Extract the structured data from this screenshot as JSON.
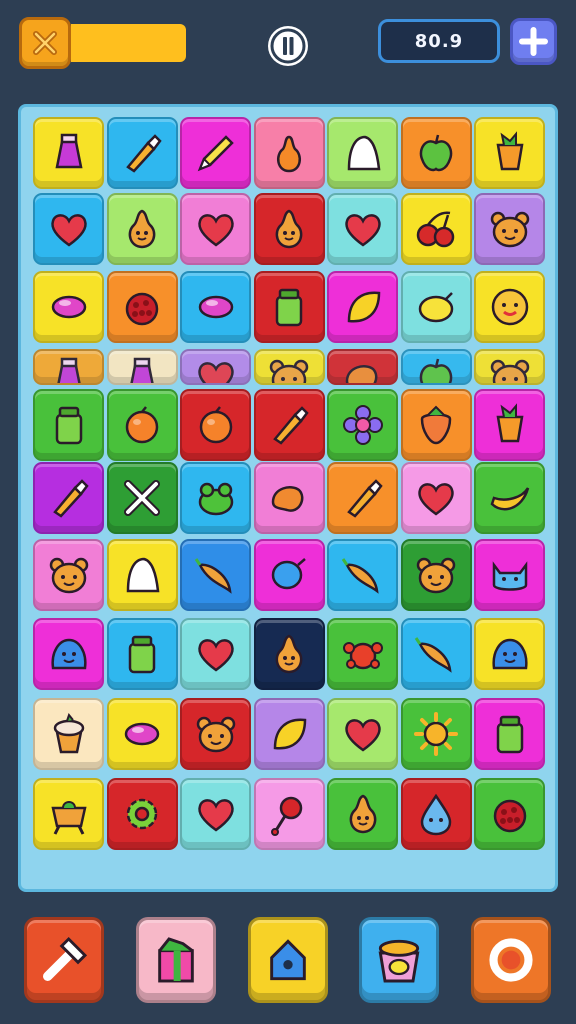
{
  "hud": {
    "score": "80.9",
    "progress": 1.0,
    "colors": {
      "accent": "#ffbf1e",
      "score_border": "#3c8fdc",
      "add": "#6f7ef0"
    }
  },
  "board": {
    "columns": 7,
    "rows": [
      {
        "half": false,
        "tiles": [
          {
            "color": "#f7e227",
            "icon": "bottle"
          },
          {
            "color": "#2fb7ef",
            "icon": "brush"
          },
          {
            "color": "#ee2fd8",
            "icon": "pencil"
          },
          {
            "color": "#f77fa8",
            "icon": "pear"
          },
          {
            "color": "#a6e86d",
            "icon": "ghost"
          },
          {
            "color": "#f7902a",
            "icon": "apple"
          },
          {
            "color": "#f7e227",
            "icon": "carrot"
          }
        ]
      },
      {
        "half": false,
        "tiles": [
          {
            "color": "#2fb7ef",
            "icon": "heart"
          },
          {
            "color": "#a6e86d",
            "icon": "pear-face"
          },
          {
            "color": "#f17ed6",
            "icon": "heart"
          },
          {
            "color": "#d6262a",
            "icon": "pear-face"
          },
          {
            "color": "#7ee0e0",
            "icon": "heart"
          },
          {
            "color": "#f7e227",
            "icon": "cherry"
          },
          {
            "color": "#b586e8",
            "icon": "bear"
          }
        ]
      },
      {
        "half": false,
        "tiles": [
          {
            "color": "#f7e227",
            "icon": "candy"
          },
          {
            "color": "#f7902a",
            "icon": "berry"
          },
          {
            "color": "#2fb7ef",
            "icon": "candy"
          },
          {
            "color": "#d6262a",
            "icon": "jar"
          },
          {
            "color": "#ee2fd8",
            "icon": "leaf"
          },
          {
            "color": "#7ee0e0",
            "icon": "lemon"
          },
          {
            "color": "#f7e227",
            "icon": "sun-face"
          }
        ]
      },
      {
        "half": true,
        "tiles": [
          {
            "color": "#f7a62a",
            "icon": "bottle"
          },
          {
            "color": "#fbe7bf",
            "icon": "bottle"
          },
          {
            "color": "#b586e8",
            "icon": "heart"
          },
          {
            "color": "#f7e227",
            "icon": "bear"
          },
          {
            "color": "#d6262a",
            "icon": "bean"
          },
          {
            "color": "#2fb7ef",
            "icon": "apple"
          },
          {
            "color": "#f7e227",
            "icon": "bear"
          }
        ]
      },
      {
        "half": false,
        "tiles": [
          {
            "color": "#49c13b",
            "icon": "jar"
          },
          {
            "color": "#49c13b",
            "icon": "orange"
          },
          {
            "color": "#d6262a",
            "icon": "orange"
          },
          {
            "color": "#d6262a",
            "icon": "brush"
          },
          {
            "color": "#49c13b",
            "icon": "flower"
          },
          {
            "color": "#f7902a",
            "icon": "strawberry"
          },
          {
            "color": "#ee2fd8",
            "icon": "carrot"
          }
        ]
      },
      {
        "half": false,
        "tiles": [
          {
            "color": "#b62ee0",
            "icon": "brush"
          },
          {
            "color": "#2e9e34",
            "icon": "cross"
          },
          {
            "color": "#2fb7ef",
            "icon": "frog"
          },
          {
            "color": "#f17ed6",
            "icon": "bean"
          },
          {
            "color": "#f7902a",
            "icon": "brush"
          },
          {
            "color": "#f59ae6",
            "icon": "heart"
          },
          {
            "color": "#49c13b",
            "icon": "banana"
          }
        ]
      },
      {
        "half": false,
        "tiles": [
          {
            "color": "#f17ed6",
            "icon": "bear"
          },
          {
            "color": "#f7e227",
            "icon": "ghost"
          },
          {
            "color": "#2f8ee8",
            "icon": "chili"
          },
          {
            "color": "#ee2fd8",
            "icon": "balloon"
          },
          {
            "color": "#2fb7ef",
            "icon": "chili"
          },
          {
            "color": "#2e9e34",
            "icon": "bear"
          },
          {
            "color": "#ee2fd8",
            "icon": "cat"
          }
        ]
      },
      {
        "half": false,
        "tiles": [
          {
            "color": "#ee2fd8",
            "icon": "blob"
          },
          {
            "color": "#2fb7ef",
            "icon": "jar"
          },
          {
            "color": "#7ee0e0",
            "icon": "heart"
          },
          {
            "color": "#162a52",
            "icon": "pear-face"
          },
          {
            "color": "#49c13b",
            "icon": "crab"
          },
          {
            "color": "#2fb7ef",
            "icon": "chili"
          },
          {
            "color": "#f7e227",
            "icon": "blob"
          }
        ]
      },
      {
        "half": false,
        "tiles": [
          {
            "color": "#fbe7bf",
            "icon": "cupcake"
          },
          {
            "color": "#f7e227",
            "icon": "candy"
          },
          {
            "color": "#d6262a",
            "icon": "bear"
          },
          {
            "color": "#b586e8",
            "icon": "leaf"
          },
          {
            "color": "#a6e86d",
            "icon": "heart"
          },
          {
            "color": "#49c13b",
            "icon": "sun"
          },
          {
            "color": "#ee2fd8",
            "icon": "jar"
          }
        ]
      },
      {
        "half": false,
        "tiles": [
          {
            "color": "#f7e227",
            "icon": "pot"
          },
          {
            "color": "#d6262a",
            "icon": "gear"
          },
          {
            "color": "#7ee0e0",
            "icon": "heart"
          },
          {
            "color": "#f59ae6",
            "icon": "lollipop"
          },
          {
            "color": "#49c13b",
            "icon": "pear-face"
          },
          {
            "color": "#d6262a",
            "icon": "drop"
          },
          {
            "color": "#49c13b",
            "icon": "berry"
          }
        ]
      }
    ]
  },
  "bottom_bar": [
    {
      "name": "hammer-button",
      "color": "#e8512a",
      "icon": "hammer"
    },
    {
      "name": "gift-box-button",
      "color": "#f7b8c8",
      "icon": "gift"
    },
    {
      "name": "birdhouse-button",
      "color": "#f7d227",
      "icon": "house"
    },
    {
      "name": "bucket-button",
      "color": "#3fb0ee",
      "icon": "bucket"
    },
    {
      "name": "ring-button",
      "color": "#ee7628",
      "icon": "ring"
    }
  ]
}
